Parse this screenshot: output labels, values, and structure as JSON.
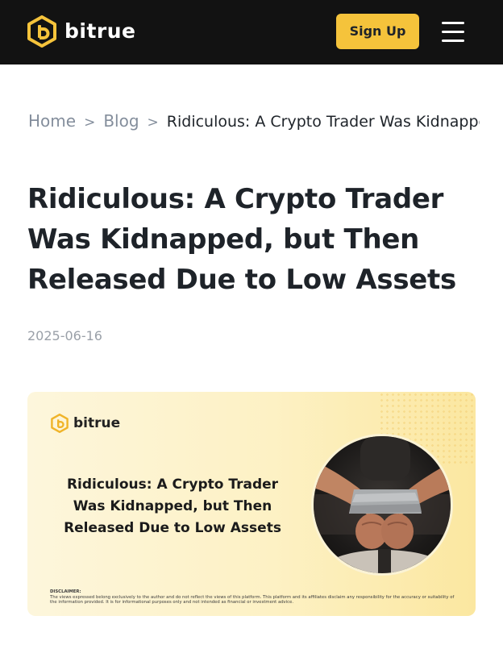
{
  "header": {
    "brand": "bitrue",
    "signup_label": "Sign Up",
    "accent_color": "#f5c33b",
    "background_color": "#121212",
    "icons": [
      "bitrue-logo-icon",
      "hamburger-menu-icon"
    ]
  },
  "breadcrumb": {
    "home": "Home",
    "separator": ">",
    "blog": "Blog",
    "current": "Ridiculous: A Crypto Trader Was Kidnapped, but Then Released Due to Low Assets"
  },
  "article": {
    "title": "Ridiculous: A Crypto Trader Was Kidnapped, but Then Released Due to Low Assets",
    "date": "2025-06-16"
  },
  "banner": {
    "brand": "bitrue",
    "headline": "Ridiculous: A Crypto Trader Was Kidnapped, but Then Released Due to Low Assets",
    "disclaimer_title": "DISCLAIMER:",
    "disclaimer_text": "The views expressed belong exclusively to the author and do not reflect the views of this platform. This platform and its affiliates disclaim any responsibility for the accuracy or suitability of the information provided. It is for informational purposes only and not intended as financial or investment advice.",
    "photo_icon": "taped-wrists-photo"
  }
}
